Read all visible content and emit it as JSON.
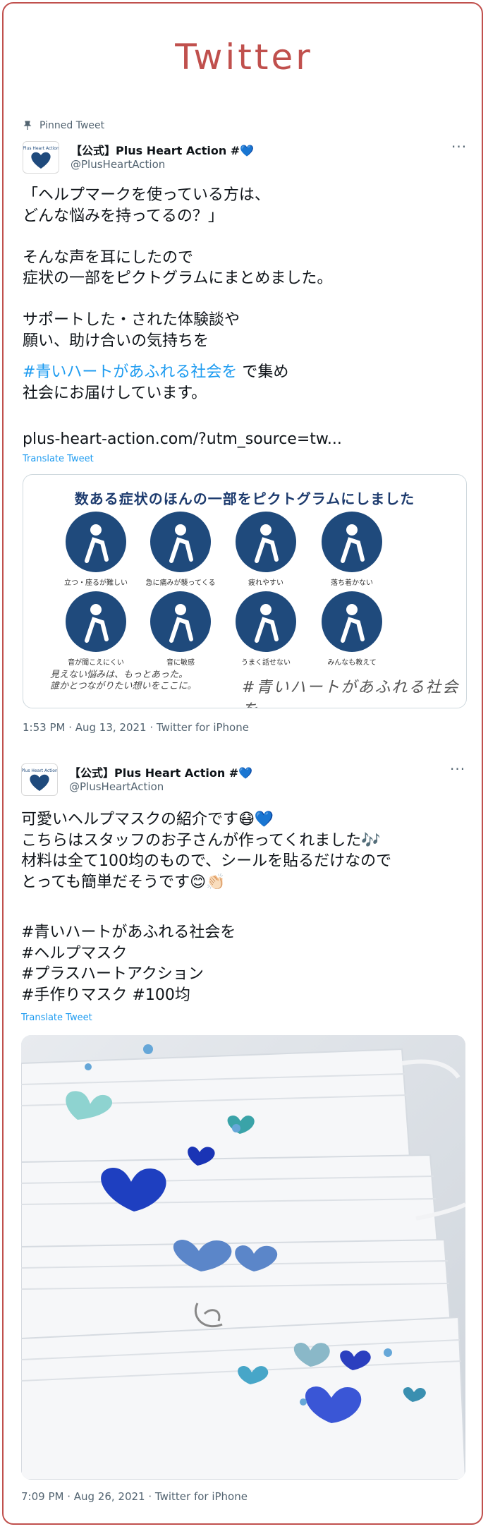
{
  "page": {
    "title": "Twitter"
  },
  "tweet1": {
    "pinned_label": "Pinned Tweet",
    "author_name": "【公式】Plus Heart Action #💙",
    "author_handle": "@PlusHeartAction",
    "more": "···",
    "text_main": "「ヘルプマークを使っている方は、\nどんな悩みを持ってるの？」\n\nそんな声を耳にしたので\n症状の一部をピクトグラムにまとめました。\n\nサポートした・された体験談や\n願い、助け合いの気持ちを",
    "hashtag": "#青いハートがあふれる社会を",
    "hashtag_tail": " で集め",
    "text_after": "社会にお届けしています。",
    "link": "plus-heart-action.com/?utm_source=tw...",
    "translate": "Translate Tweet",
    "card": {
      "title": "数ある症状のほんの一部をピクトグラムにしました",
      "pictos": [
        "立つ・座るが難しい",
        "急に痛みが襲ってくる",
        "疲れやすい",
        "落ち着かない",
        "音が聞こえにくい",
        "音に敏感",
        "うまく話せない",
        "みんなも教えて"
      ],
      "handwritten_left": "見えない悩みは、もっとあった。\n誰かとつながりたい想いをここに。",
      "handwritten_right": "#青いハートがあふれる社会を"
    },
    "meta": "1:53 PM · Aug 13, 2021 · Twitter for iPhone"
  },
  "tweet2": {
    "author_name": "【公式】Plus Heart Action #💙",
    "author_handle": "@PlusHeartAction",
    "more": "···",
    "text": "可愛いヘルプマスクの紹介です😷💙\nこちらはスタッフのお子さんが作ってくれました🎶\n材料は全て100均のもので、シールを貼るだけなので\nとっても簡単だそうです😊👏🏻",
    "hashtags": "#青いハートがあふれる社会を\n#ヘルプマスク\n#プラスハートアクション\n#手作りマスク #100均",
    "translate": "Translate Tweet",
    "meta": "7:09 PM · Aug 26, 2021 · Twitter for iPhone"
  },
  "colors": {
    "frame": "#c0504d",
    "link": "#1d9bf0",
    "picto": "#1f4a7c"
  },
  "icons": {
    "pin": "pin-icon",
    "more": "more-icon",
    "avatar": "avatar-logo"
  }
}
